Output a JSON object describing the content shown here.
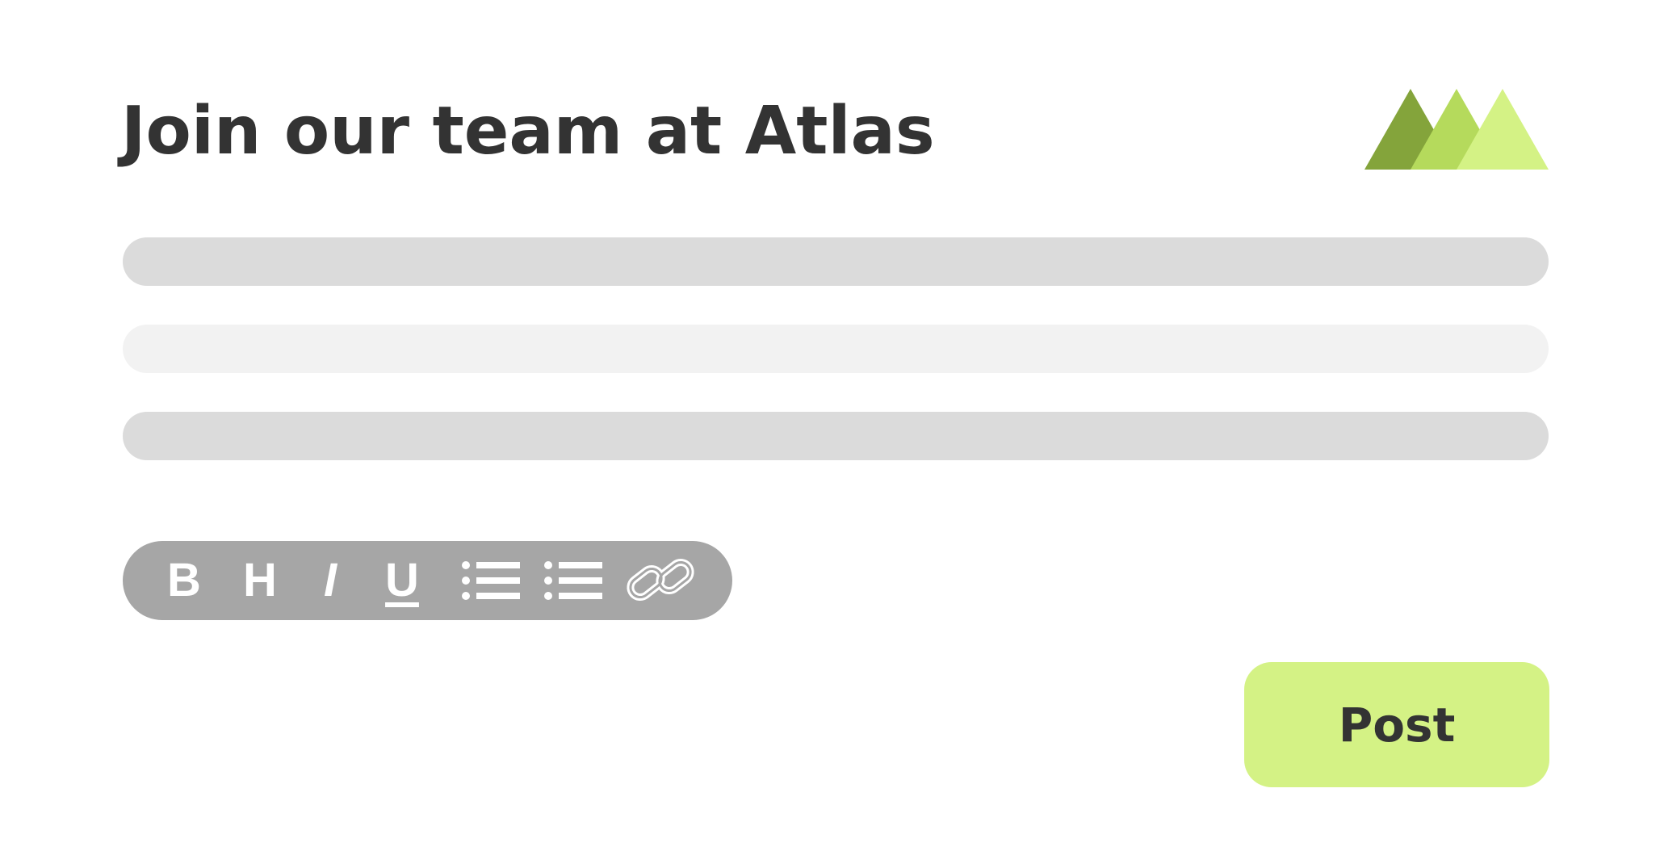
{
  "header": {
    "title": "Join our team at Atlas"
  },
  "logo": {
    "icon": "mountain-triangles-logo",
    "colors": [
      "#84a43b",
      "#b5da5c",
      "#d4f285"
    ]
  },
  "form": {
    "fields": [
      {
        "value": "",
        "placeholder": ""
      },
      {
        "value": "",
        "placeholder": ""
      },
      {
        "value": "",
        "placeholder": ""
      }
    ]
  },
  "toolbar": {
    "bold_label": "B",
    "heading_label": "H",
    "italic_label": "I",
    "underline_label": "U",
    "icons": [
      "bold-icon",
      "heading-icon",
      "italic-icon",
      "underline-icon",
      "bullet-list-icon",
      "numbered-list-icon",
      "link-icon"
    ]
  },
  "actions": {
    "post_label": "Post"
  },
  "colors": {
    "text": "#333333",
    "accent": "#d4f285",
    "toolbar_bg": "#a6a6a6",
    "field_dark": "#dbdbdb",
    "field_light": "#f2f2f2"
  }
}
